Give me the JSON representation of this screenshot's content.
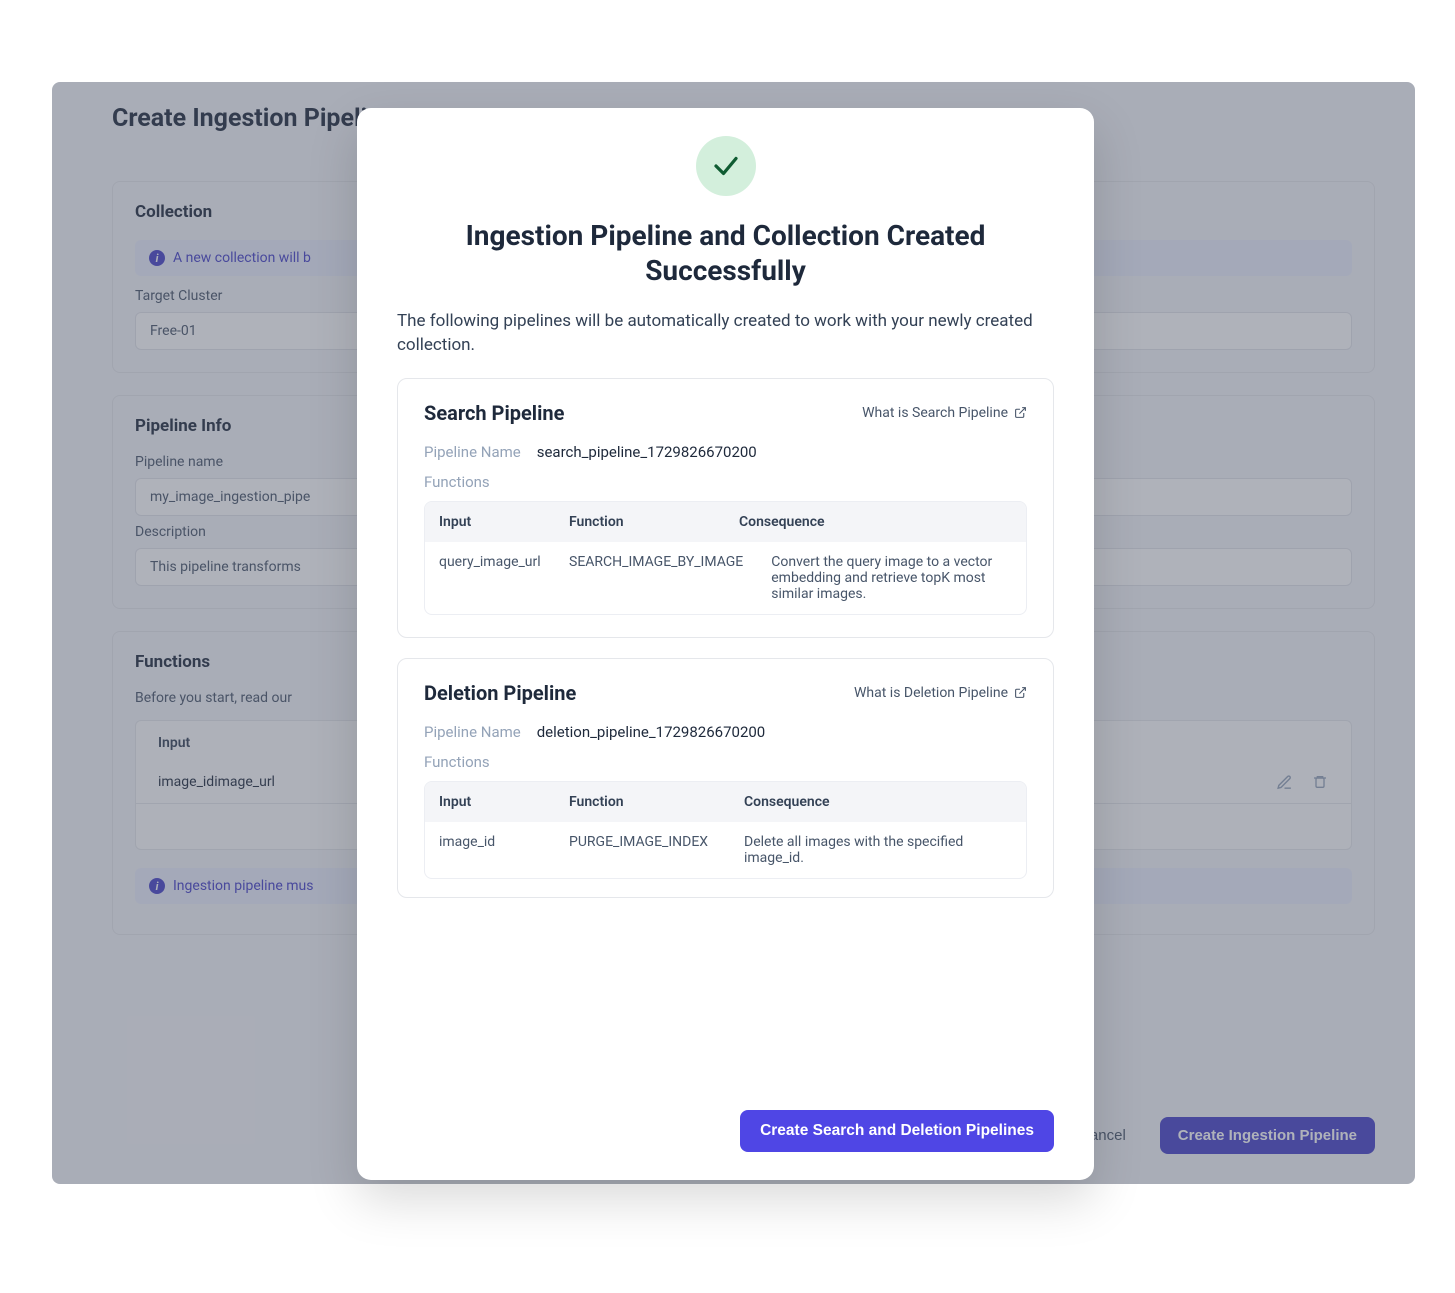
{
  "page": {
    "title": "Create Ingestion Pipeline",
    "collection": {
      "heading": "Collection",
      "notice": "A new collection will b",
      "target_cluster_label": "Target Cluster",
      "target_cluster_value": "Free-01"
    },
    "pipeline_info": {
      "heading": "Pipeline Info",
      "name_label": "Pipeline name",
      "name_value": "my_image_ingestion_pipe",
      "desc_label": "Description",
      "desc_value": "This pipeline transforms"
    },
    "functions": {
      "heading": "Functions",
      "intro": "Before you start, read our",
      "col_input": "Input",
      "row0_value": "image_idimage_url",
      "footer_notice": "Ingestion pipeline mus"
    },
    "footer": {
      "cancel": "Cancel",
      "create": "Create Ingestion Pipeline"
    }
  },
  "modal": {
    "title": "Ingestion Pipeline and Collection Created Successfully",
    "lead": "The following pipelines will be automatically created to work with your newly created collection.",
    "search": {
      "heading": "Search Pipeline",
      "what_link": "What is Search Pipeline",
      "pipeline_name_label": "Pipeline Name",
      "pipeline_name_value": "search_pipeline_1729826670200",
      "functions_label": "Functions",
      "cols": {
        "input": "Input",
        "function": "Function",
        "consequence": "Consequence"
      },
      "row": {
        "input": "query_image_url",
        "function": "SEARCH_IMAGE_BY_IMAGE",
        "consequence": "Convert the query image to a vector embedding and retrieve topK most similar images."
      }
    },
    "deletion": {
      "heading": "Deletion Pipeline",
      "what_link": "What is Deletion Pipeline",
      "pipeline_name_label": "Pipeline Name",
      "pipeline_name_value": "deletion_pipeline_1729826670200",
      "functions_label": "Functions",
      "cols": {
        "input": "Input",
        "function": "Function",
        "consequence": "Consequence"
      },
      "row": {
        "input": "image_id",
        "function": "PURGE_IMAGE_INDEX",
        "consequence": "Delete all images with the specified image_id."
      }
    },
    "cta": "Create Search and Deletion Pipelines"
  }
}
